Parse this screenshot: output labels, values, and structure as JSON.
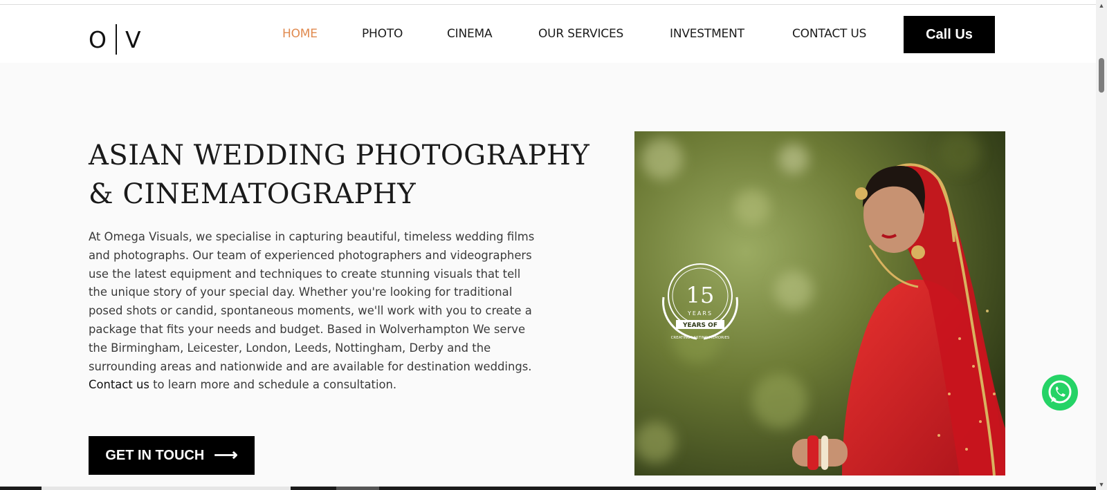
{
  "header": {
    "logo_left": "O",
    "logo_right": "V",
    "nav": [
      {
        "label": "HOME",
        "active": true
      },
      {
        "label": "PHOTO",
        "active": false
      },
      {
        "label": "CINEMA",
        "active": false
      },
      {
        "label": "OUR SERVICES",
        "active": false
      },
      {
        "label": "INVESTMENT",
        "active": false
      },
      {
        "label": "CONTACT US",
        "active": false
      }
    ],
    "call_label": "Call Us"
  },
  "hero": {
    "title": "ASIAN WEDDING PHOTOGRAPHY\n& CINEMATOGRAPHY",
    "description": "At Omega Visuals, we specialise in capturing beautiful, timeless wedding films and photographs. Our team of experienced photographers and videographers use the latest equipment and techniques to create stunning visuals that tell the unique story of your special day. Whether you're looking for traditional posed shots or candid, spontaneous moments, we'll work with you to create a package that fits your needs and budget. Based in Wolverhampton We serve the Birmingham, Leicester, London, Leeds, Nottingham, Derby and the surrounding areas and nationwide and are available for destination weddings.",
    "contact_link": "Contact us",
    "contact_tail": " to learn more and schedule a consultation.",
    "cta_label": "GET IN TOUCH",
    "badge": {
      "number": "15",
      "years_small": "YEARS",
      "years_ribbon": "YEARS OF",
      "tagline": "CREATING LASTING MEMORIES"
    }
  },
  "colors": {
    "accent": "#e08a4f",
    "button_bg": "#000000",
    "hero_bg": "#fafafa",
    "whatsapp": "#25d366",
    "dress_red": "#d41f24"
  },
  "icons": {
    "cta": "arrow-right-icon",
    "floating": "whatsapp-icon"
  }
}
